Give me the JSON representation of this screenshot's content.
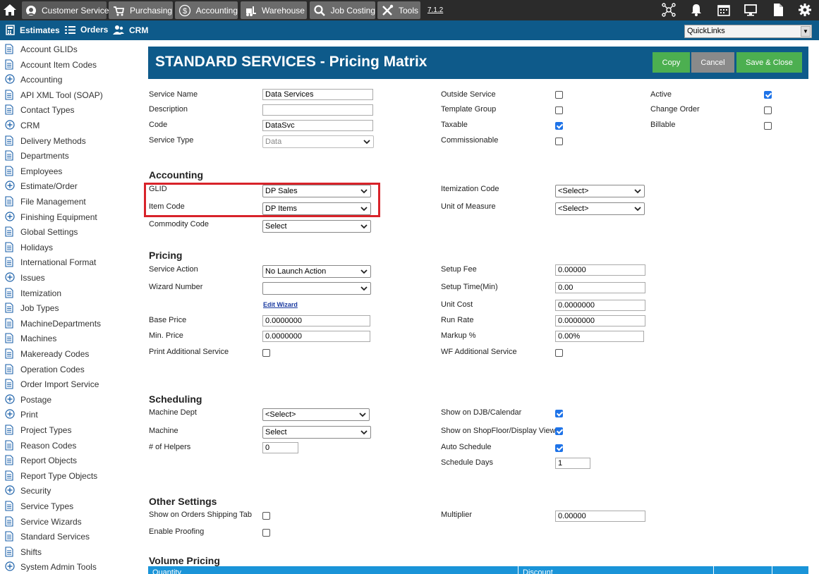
{
  "topnav": {
    "modules": [
      {
        "label": "Customer Service",
        "icon": "headset-icon"
      },
      {
        "label": "Purchasing",
        "icon": "cart-icon"
      },
      {
        "label": "Accounting",
        "icon": "dollar-icon"
      },
      {
        "label": "Warehouse",
        "icon": "forklift-icon"
      },
      {
        "label": "Job Costing",
        "icon": "magnifier-icon"
      },
      {
        "label": "Tools",
        "icon": "tools-icon"
      }
    ],
    "version": "7.1.2"
  },
  "subnav": {
    "items": [
      {
        "label": "Estimates",
        "icon": "calculator-icon"
      },
      {
        "label": "Orders",
        "icon": "list-icon"
      },
      {
        "label": "CRM",
        "icon": "contacts-icon"
      }
    ],
    "quicklinks": "QuickLinks"
  },
  "sidebar": {
    "items": [
      {
        "label": "Account GLIDs",
        "icon": "doc"
      },
      {
        "label": "Account Item Codes",
        "icon": "doc"
      },
      {
        "label": "Accounting",
        "icon": "plus"
      },
      {
        "label": "API XML Tool (SOAP)",
        "icon": "doc"
      },
      {
        "label": "Contact Types",
        "icon": "doc"
      },
      {
        "label": "CRM",
        "icon": "plus"
      },
      {
        "label": "Delivery Methods",
        "icon": "doc"
      },
      {
        "label": "Departments",
        "icon": "doc"
      },
      {
        "label": "Employees",
        "icon": "doc"
      },
      {
        "label": "Estimate/Order",
        "icon": "plus"
      },
      {
        "label": "File Management",
        "icon": "doc"
      },
      {
        "label": "Finishing Equipment",
        "icon": "plus"
      },
      {
        "label": "Global Settings",
        "icon": "doc"
      },
      {
        "label": "Holidays",
        "icon": "doc"
      },
      {
        "label": "International Format",
        "icon": "doc"
      },
      {
        "label": "Issues",
        "icon": "plus"
      },
      {
        "label": "Itemization",
        "icon": "doc"
      },
      {
        "label": "Job Types",
        "icon": "doc"
      },
      {
        "label": "MachineDepartments",
        "icon": "doc"
      },
      {
        "label": "Machines",
        "icon": "doc"
      },
      {
        "label": "Makeready Codes",
        "icon": "doc"
      },
      {
        "label": "Operation Codes",
        "icon": "doc"
      },
      {
        "label": "Order Import Service",
        "icon": "doc"
      },
      {
        "label": "Postage",
        "icon": "plus"
      },
      {
        "label": "Print",
        "icon": "plus"
      },
      {
        "label": "Project Types",
        "icon": "doc"
      },
      {
        "label": "Reason Codes",
        "icon": "doc"
      },
      {
        "label": "Report Objects",
        "icon": "doc"
      },
      {
        "label": "Report Type Objects",
        "icon": "doc"
      },
      {
        "label": "Security",
        "icon": "plus"
      },
      {
        "label": "Service Types",
        "icon": "doc"
      },
      {
        "label": "Service Wizards",
        "icon": "doc"
      },
      {
        "label": "Standard Services",
        "icon": "doc"
      },
      {
        "label": "Shifts",
        "icon": "doc"
      },
      {
        "label": "System Admin Tools",
        "icon": "plus"
      }
    ]
  },
  "header": {
    "title": "STANDARD SERVICES - Pricing Matrix",
    "copy": "Copy",
    "cancel": "Cancel",
    "save": "Save & Close"
  },
  "general": {
    "service_name_label": "Service Name",
    "service_name": "Data Services",
    "description_label": "Description",
    "description": "",
    "code_label": "Code",
    "code": "DataSvc",
    "service_type_label": "Service Type",
    "service_type": "Data",
    "outside_service_label": "Outside Service",
    "outside_service": false,
    "template_group_label": "Template Group",
    "template_group": false,
    "taxable_label": "Taxable",
    "taxable": true,
    "commissionable_label": "Commissionable",
    "commissionable": false,
    "active_label": "Active",
    "active": true,
    "change_order_label": "Change Order",
    "change_order": false,
    "billable_label": "Billable",
    "billable": false
  },
  "accounting": {
    "title": "Accounting",
    "glid_label": "GLID",
    "glid": "DP Sales",
    "item_code_label": "Item Code",
    "item_code": "DP Items",
    "commodity_code_label": "Commodity Code",
    "commodity_code": "Select",
    "itemization_code_label": "Itemization Code",
    "itemization_code": "<Select>",
    "unit_of_measure_label": "Unit of Measure",
    "unit_of_measure": "<Select>"
  },
  "pricing": {
    "title": "Pricing",
    "service_action_label": "Service Action",
    "service_action": "No Launch Action",
    "wizard_number_label": "Wizard Number",
    "wizard_number": "",
    "edit_wizard": "Edit Wizard",
    "base_price_label": "Base Price",
    "base_price": "0.0000000",
    "min_price_label": "Min. Price",
    "min_price": "0.0000000",
    "print_additional_label": "Print Additional Service",
    "print_additional": false,
    "setup_fee_label": "Setup Fee",
    "setup_fee": "0.00000",
    "setup_time_label": "Setup Time(Min)",
    "setup_time": "0.00",
    "unit_cost_label": "Unit Cost",
    "unit_cost": "0.0000000",
    "run_rate_label": "Run Rate",
    "run_rate": "0.0000000",
    "markup_label": "Markup %",
    "markup": "0.00%",
    "wf_additional_label": "WF Additional Service",
    "wf_additional": false
  },
  "scheduling": {
    "title": "Scheduling",
    "machine_dept_label": "Machine Dept",
    "machine_dept": "<Select>",
    "machine_label": "Machine",
    "machine": "Select",
    "helpers_label": "# of Helpers",
    "helpers": "0",
    "show_djb_label": "Show on DJB/Calendar",
    "show_djb": true,
    "show_shopfloor_label": "Show on ShopFloor/Display View",
    "show_shopfloor": true,
    "auto_schedule_label": "Auto Schedule",
    "auto_schedule": true,
    "schedule_days_label": "Schedule Days",
    "schedule_days": "1"
  },
  "other": {
    "title": "Other Settings",
    "show_shipping_label": "Show on Orders Shipping Tab",
    "show_shipping": false,
    "enable_proofing_label": "Enable Proofing",
    "enable_proofing": false,
    "multiplier_label": "Multiplier",
    "multiplier": "0.00000"
  },
  "volume": {
    "title": "Volume Pricing",
    "col_quantity": "Quantity",
    "col_discount": "Discount"
  }
}
